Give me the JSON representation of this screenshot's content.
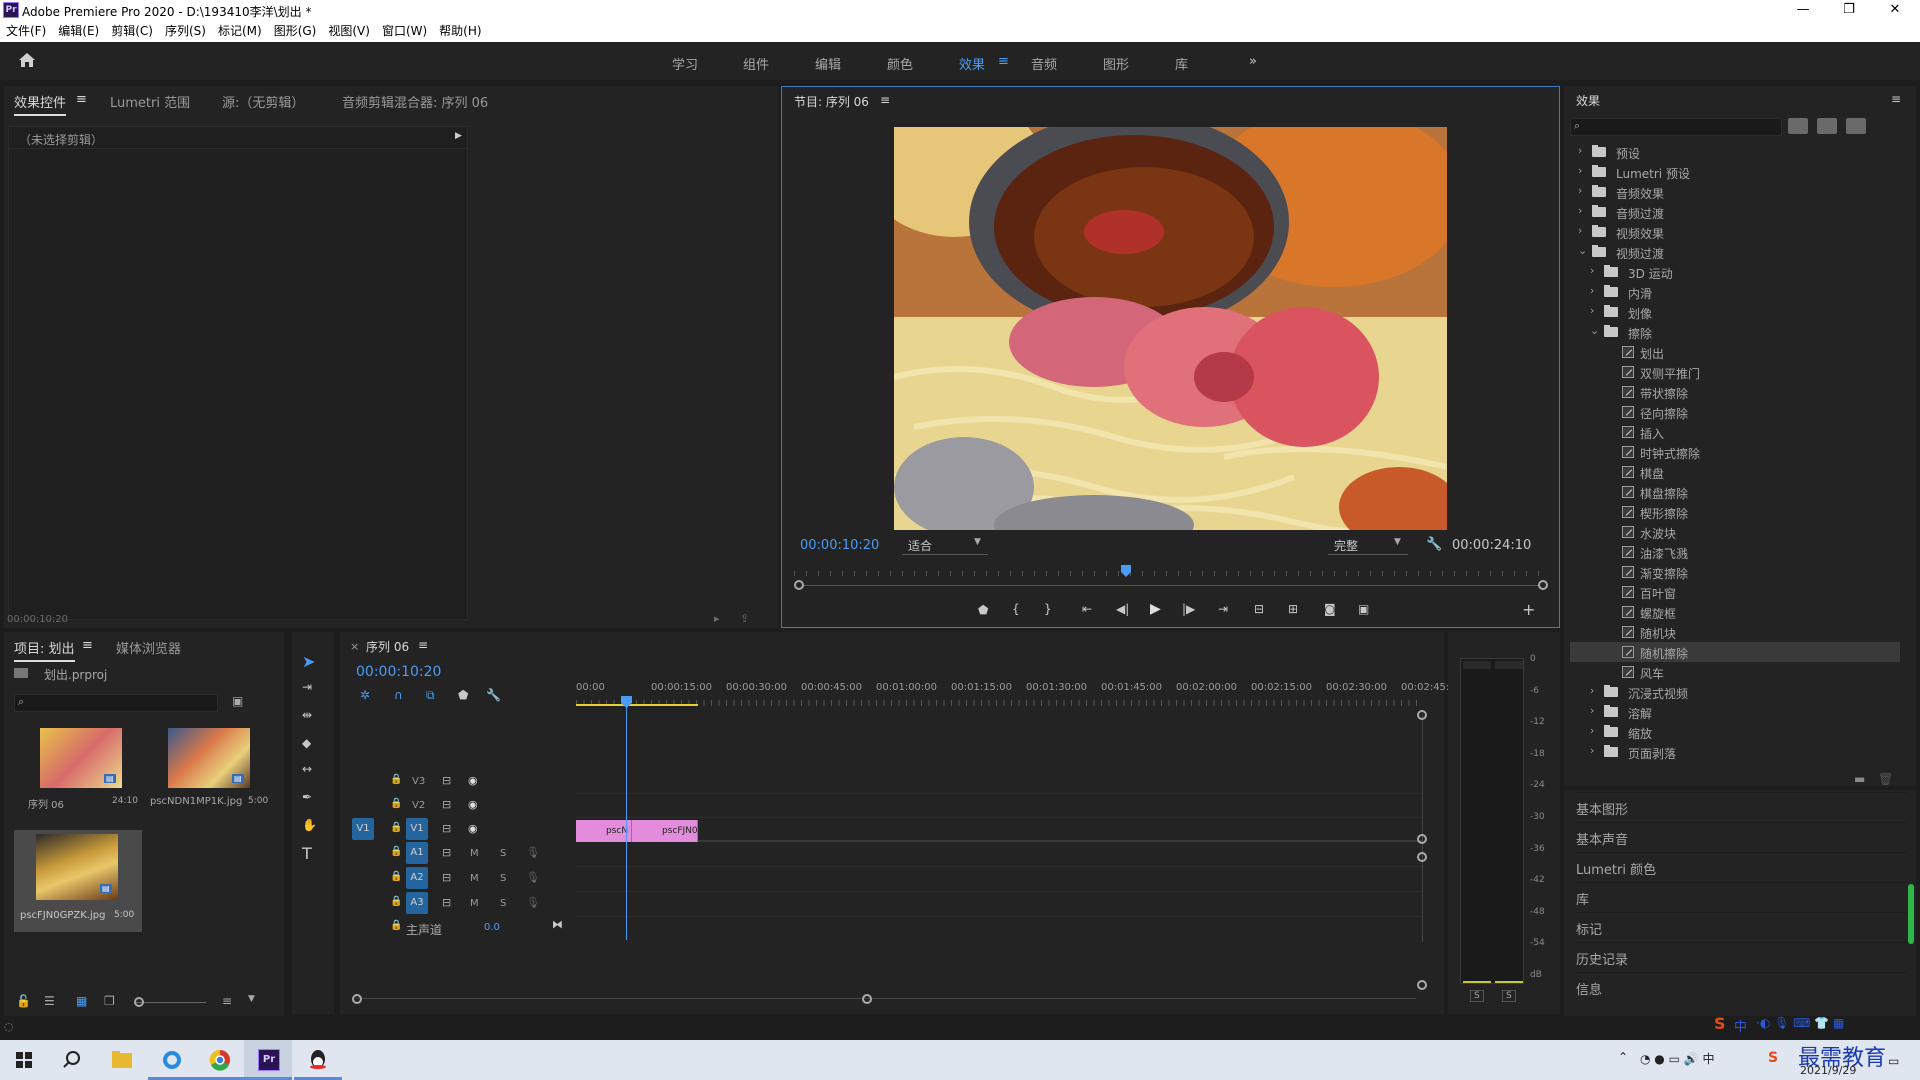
{
  "window": {
    "title": "Adobe Premiere Pro 2020 - D:\\193410李洋\\划出 *",
    "app_icon_text": "Pr",
    "minimize": "—",
    "maximize": "❐",
    "close": "✕"
  },
  "menu": [
    "文件(F)",
    "编辑(E)",
    "剪辑(C)",
    "序列(S)",
    "标记(M)",
    "图形(G)",
    "视图(V)",
    "窗口(W)",
    "帮助(H)"
  ],
  "workspaces": [
    "学习",
    "组件",
    "编辑",
    "颜色",
    "效果",
    "音频",
    "图形",
    "库"
  ],
  "workspace_active": "效果",
  "workspace_more": "»",
  "source_panel": {
    "tabs": [
      "效果控件",
      "Lumetri 范围",
      "源:（无剪辑）",
      "音频剪辑混合器: 序列 06"
    ],
    "no_clip": "（未选择剪辑）",
    "timecode": "00:00:10:20"
  },
  "program": {
    "title": "节目: 序列 06",
    "timecode": "00:00:10:20",
    "fit": "适合",
    "quality": "完整",
    "duration": "00:00:24:10",
    "playhead_fraction": 0.44
  },
  "effects": {
    "title": "效果",
    "tree": [
      {
        "label": "预设",
        "level": 0,
        "type": "folder",
        "open": false
      },
      {
        "label": "Lumetri 预设",
        "level": 0,
        "type": "folder",
        "open": false
      },
      {
        "label": "音频效果",
        "level": 0,
        "type": "folder",
        "open": false
      },
      {
        "label": "音频过渡",
        "level": 0,
        "type": "folder",
        "open": false
      },
      {
        "label": "视频效果",
        "level": 0,
        "type": "folder",
        "open": false
      },
      {
        "label": "视频过渡",
        "level": 0,
        "type": "folder",
        "open": true
      },
      {
        "label": "3D 运动",
        "level": 1,
        "type": "folder",
        "open": false
      },
      {
        "label": "内滑",
        "level": 1,
        "type": "folder",
        "open": false
      },
      {
        "label": "划像",
        "level": 1,
        "type": "folder",
        "open": false
      },
      {
        "label": "擦除",
        "level": 1,
        "type": "folder",
        "open": true
      },
      {
        "label": "划出",
        "level": 2,
        "type": "fx"
      },
      {
        "label": "双侧平推门",
        "level": 2,
        "type": "fx"
      },
      {
        "label": "带状擦除",
        "level": 2,
        "type": "fx"
      },
      {
        "label": "径向擦除",
        "level": 2,
        "type": "fx"
      },
      {
        "label": "插入",
        "level": 2,
        "type": "fx"
      },
      {
        "label": "时钟式擦除",
        "level": 2,
        "type": "fx"
      },
      {
        "label": "棋盘",
        "level": 2,
        "type": "fx"
      },
      {
        "label": "棋盘擦除",
        "level": 2,
        "type": "fx"
      },
      {
        "label": "楔形擦除",
        "level": 2,
        "type": "fx"
      },
      {
        "label": "水波块",
        "level": 2,
        "type": "fx"
      },
      {
        "label": "油漆飞溅",
        "level": 2,
        "type": "fx"
      },
      {
        "label": "渐变擦除",
        "level": 2,
        "type": "fx"
      },
      {
        "label": "百叶窗",
        "level": 2,
        "type": "fx"
      },
      {
        "label": "螺旋框",
        "level": 2,
        "type": "fx"
      },
      {
        "label": "随机块",
        "level": 2,
        "type": "fx"
      },
      {
        "label": "随机擦除",
        "level": 2,
        "type": "fx",
        "selected": true
      },
      {
        "label": "风车",
        "level": 2,
        "type": "fx"
      },
      {
        "label": "沉浸式视频",
        "level": 1,
        "type": "folder",
        "open": false
      },
      {
        "label": "溶解",
        "level": 1,
        "type": "folder",
        "open": false
      },
      {
        "label": "缩放",
        "level": 1,
        "type": "folder",
        "open": false
      },
      {
        "label": "页面剥落",
        "level": 1,
        "type": "folder",
        "open": false
      }
    ],
    "panels": [
      "基本图形",
      "基本声音",
      "Lumetri 颜色",
      "库",
      "标记",
      "历史记录",
      "信息"
    ]
  },
  "project": {
    "tabs": [
      "项目: 划出",
      "媒体浏览器"
    ],
    "file": "划出.prproj",
    "items": [
      {
        "name": "序列 06",
        "duration": "24:10"
      },
      {
        "name": "pscNDN1MP1K.jpg",
        "duration": "5:00"
      },
      {
        "name": "pscFJN0GPZK.jpg",
        "duration": "5:00"
      }
    ]
  },
  "timeline": {
    "tab": "序列 06",
    "timecode": "00:00:10:20",
    "ruler": [
      "00:00",
      "00:00:15:00",
      "00:00:30:00",
      "00:00:45:00",
      "00:01:00:00",
      "00:01:15:00",
      "00:01:30:00",
      "00:01:45:00",
      "00:02:00:00",
      "00:02:15:00",
      "00:02:30:00",
      "00:02:45:"
    ],
    "video_tracks": [
      "V3",
      "V2",
      "V1"
    ],
    "audio_tracks": [
      "A1",
      "A2",
      "A3"
    ],
    "source_patch": "V1",
    "master": "主声道",
    "master_value": "0.0",
    "clips": [
      "pscN",
      "pscFJN0"
    ],
    "mute": "M",
    "solo": "S"
  },
  "meter": {
    "scale": [
      "0",
      "-6",
      "-12",
      "-18",
      "-24",
      "-30",
      "-36",
      "-42",
      "-48",
      "-54",
      "dB"
    ],
    "solo_left": "S",
    "solo_right": "S"
  },
  "taskbar": {
    "time": "2021/9/29",
    "watermark": "最需教育",
    "ime": "中"
  }
}
